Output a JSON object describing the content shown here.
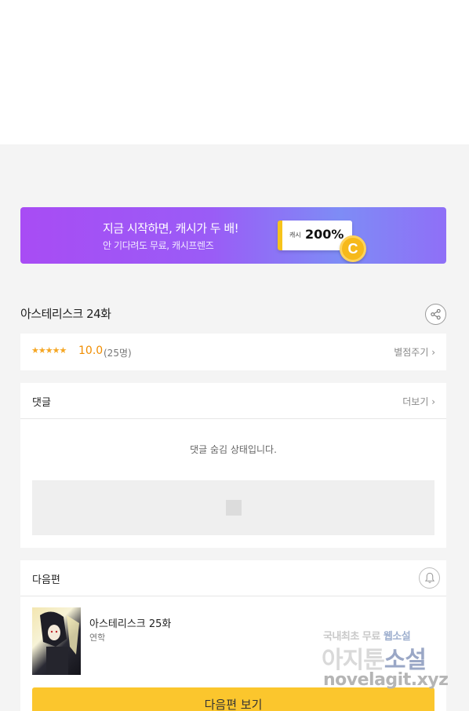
{
  "banner": {
    "title": "지금 시작하면, 캐시가 두 배!",
    "subtitle": "안 기다려도 무료, 캐시프렌즈",
    "cash_label": "캐시",
    "cash_value": "200%",
    "coin_letter": "C"
  },
  "episode": {
    "title": "아스테리스크 24화",
    "share_icon": "share-icon"
  },
  "rating": {
    "stars": "★★★★★",
    "score": "10.0",
    "count": "(25명)",
    "rate_link": "별점주기 ›"
  },
  "comments": {
    "title": "댓글",
    "more": "더보기 ›",
    "hidden_message": "댓글 숨김 상태입니다."
  },
  "next": {
    "title": "다음편",
    "bell_icon": "bell-icon",
    "episode_name": "아스테리스크 25화",
    "status": "연학",
    "button_label": "다음편 보기"
  },
  "watermark": {
    "line1a": "국내최초 무료 ",
    "line1b": "웹소설",
    "line2a": "아지툰",
    "line2b": "소설",
    "line3": "novelagit.xyz"
  },
  "colors": {
    "accent_yellow": "#fbc62d",
    "banner_purple": "#a84cf4",
    "score_orange": "#f08d00"
  }
}
